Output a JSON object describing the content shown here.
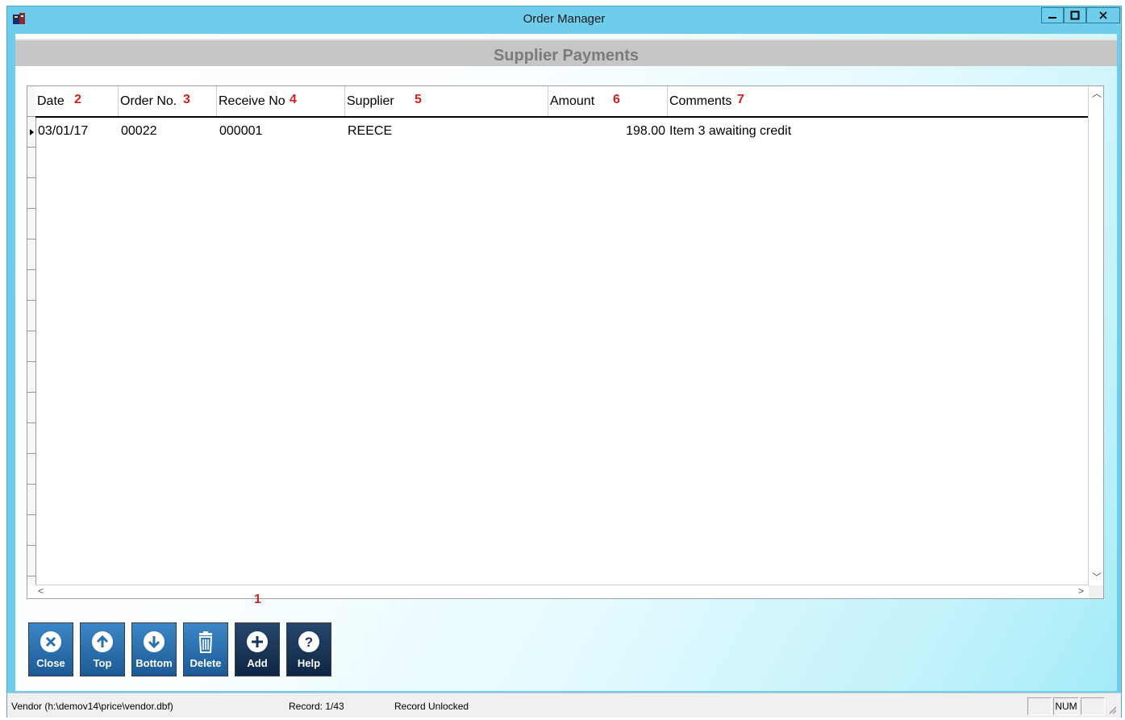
{
  "window": {
    "title": "Order Manager"
  },
  "header": {
    "title": "Supplier Payments"
  },
  "grid": {
    "columns": [
      {
        "label": "Date",
        "marker": "2"
      },
      {
        "label": "Order No.",
        "marker": "3"
      },
      {
        "label": "Receive No",
        "marker": "4"
      },
      {
        "label": "Supplier",
        "marker": "5"
      },
      {
        "label": "Amount",
        "marker": "6"
      },
      {
        "label": "Comments",
        "marker": "7"
      }
    ],
    "rows": [
      {
        "date": "03/01/17",
        "order_no": "00022",
        "receive_no": "000001",
        "supplier": "REECE",
        "amount": "198.00",
        "comments": "Item 3 awaiting credit"
      }
    ]
  },
  "annotation_marker": "1",
  "toolbar": {
    "buttons": [
      {
        "label": "Close",
        "icon": "close-icon"
      },
      {
        "label": "Top",
        "icon": "arrow-up-icon"
      },
      {
        "label": "Bottom",
        "icon": "arrow-down-icon"
      },
      {
        "label": "Delete",
        "icon": "trash-icon"
      },
      {
        "label": "Add",
        "icon": "plus-icon"
      },
      {
        "label": "Help",
        "icon": "help-icon"
      }
    ]
  },
  "status": {
    "file": "Vendor (h:\\demov14\\price\\vendor.dbf)",
    "record": "Record: 1/43",
    "lock": "Record Unlocked",
    "num": "NUM"
  },
  "colors": {
    "window_accent": "#6ecdea",
    "marker_red": "#d42020",
    "button_blue": "#2a6fae",
    "button_navy": "#1a3558"
  }
}
